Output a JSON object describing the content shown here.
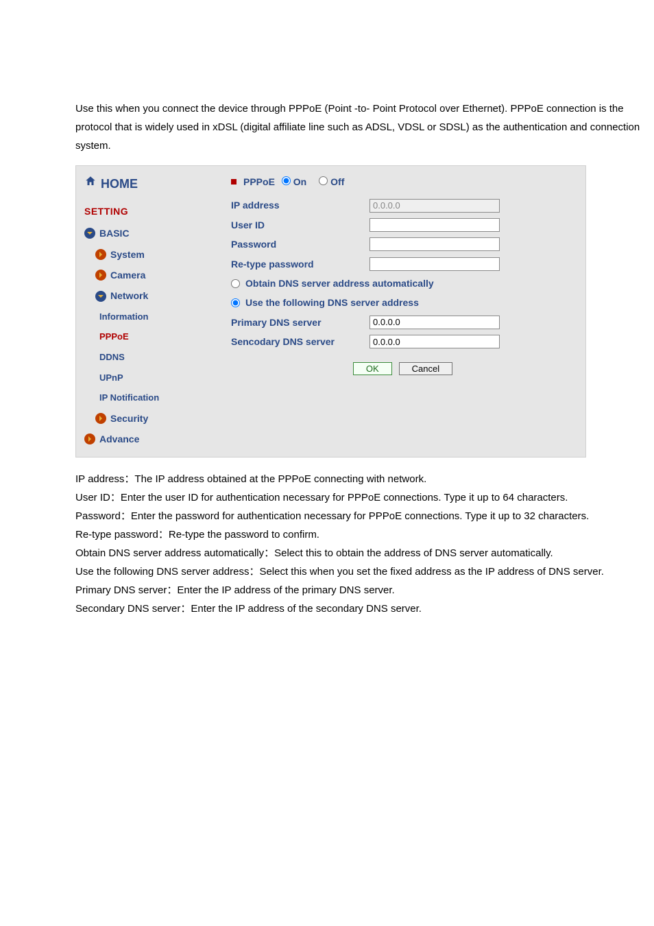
{
  "intro": {
    "paragraph": "Use this when you connect the device through PPPoE (Point -to- Point Protocol over Ethernet). PPPoE connection is the protocol that is widely used in xDSL (digital affiliate line such as ADSL, VDSL or SDSL) as the authentication and connection system."
  },
  "sidebar": {
    "home": "HOME",
    "setting": "SETTING",
    "items": [
      {
        "label": "BASIC",
        "icon": "down"
      },
      {
        "label": "System",
        "icon": "right",
        "indent": 1
      },
      {
        "label": "Camera",
        "icon": "right",
        "indent": 1
      },
      {
        "label": "Network",
        "icon": "down",
        "indent": 1
      }
    ],
    "network_subs": [
      {
        "label": "Information",
        "active": false
      },
      {
        "label": "PPPoE",
        "active": true
      },
      {
        "label": "DDNS",
        "active": false
      },
      {
        "label": "UPnP",
        "active": false
      },
      {
        "label": "IP Notification",
        "active": false
      }
    ],
    "tail": [
      {
        "label": "Security",
        "icon": "right",
        "indent": 1
      },
      {
        "label": "Advance",
        "icon": "right",
        "indent": 0
      }
    ]
  },
  "form": {
    "section": "PPPoE",
    "on": "On",
    "off": "Off",
    "ip_label": "IP address",
    "ip_value": "0.0.0.0",
    "user_label": "User ID",
    "user_value": "",
    "pw_label": "Password",
    "pw_value": "",
    "repw_label": "Re-type password",
    "repw_value": "",
    "dns_auto": "Obtain DNS server address automatically",
    "dns_manual": "Use the following DNS server address",
    "primary_label": "Primary DNS server",
    "primary_value": "0.0.0.0",
    "secondary_label": "Sencodary DNS server",
    "secondary_value": "0.0.0.0",
    "ok": "OK",
    "cancel": "Cancel"
  },
  "notes": {
    "l1": "IP address：The IP address obtained at the PPPoE connecting with network.",
    "l2": "User ID：Enter the user ID for authentication necessary for PPPoE connections. Type it up to 64 characters.",
    "l3": "Password：Enter the password for authentication necessary for PPPoE connections. Type it up to 32 characters.",
    "l4": "Re-type password：Re-type the password to confirm.",
    "l5": "Obtain DNS server address automatically：Select this to obtain the address of DNS server automatically.",
    "l6": "Use the following DNS server address：Select this when you set the fixed address as the IP address of DNS server.",
    "l7": "Primary DNS server：Enter the IP address of the primary DNS server.",
    "l8": "Secondary DNS server：Enter the IP address of the secondary DNS server."
  }
}
